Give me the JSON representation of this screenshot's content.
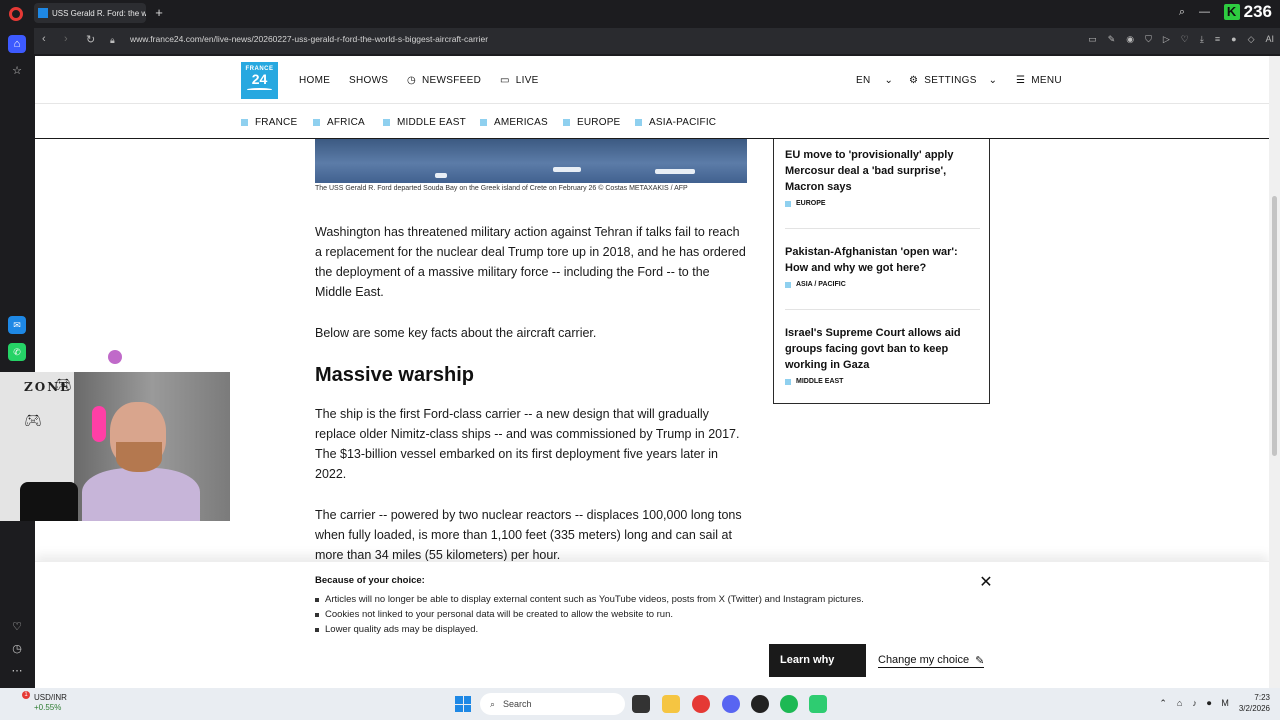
{
  "browser": {
    "tab_title": "USS Gerald R. Ford: the w",
    "url": "www.france24.com/en/live-news/20260227-uss-gerald-r-ford-the-world-s-biggest-aircraft-carrier",
    "counter_value": "236",
    "counter_badge": "K",
    "ai_label": "AI"
  },
  "header": {
    "logo_line1": "FRANCE",
    "logo_line2": "24",
    "nav": {
      "home": "HOME",
      "shows": "SHOWS",
      "newsfeed": "NEWSFEED",
      "live": "LIVE",
      "lang": "EN",
      "settings": "SETTINGS",
      "menu": "MENU"
    },
    "subnav": [
      "FRANCE",
      "AFRICA",
      "MIDDLE EAST",
      "AMERICAS",
      "EUROPE",
      "ASIA-PACIFIC"
    ]
  },
  "article": {
    "caption": "The USS Gerald R. Ford departed Souda Bay on the Greek island of Crete on February 26  © Costas METAXAKIS / AFP",
    "p1": "Washington has threatened military action against Tehran if talks fail to reach a replacement for the nuclear deal Trump tore up in 2018, and he has ordered the deployment of a massive military force -- including the Ford -- to the Middle East.",
    "p2": "Below are some key facts about the aircraft carrier.",
    "h2": "Massive warship",
    "p3": "The ship is the first Ford-class carrier -- a new design that will gradually replace older Nimitz-class ships -- and was commissioned by Trump in 2017. The $13-billion vessel embarked on its first deployment five years later in 2022.",
    "p4": "The carrier -- powered by two nuclear reactors -- displaces 100,000 long tons when fully loaded, is more than 1,100 feet (335 meters) long and can sail at more than 34 miles (55 kilometers) per hour."
  },
  "sidebar_news": [
    {
      "title": "EU move to 'provisionally' apply Mercosur deal a 'bad surprise', Macron says",
      "tag": "EUROPE"
    },
    {
      "title": "Pakistan-Afghanistan 'open war': How and why we got here?",
      "tag": "ASIA / PACIFIC"
    },
    {
      "title": "Israel's Supreme Court allows aid groups facing govt ban to keep working in Gaza",
      "tag": "MIDDLE EAST"
    }
  ],
  "consent": {
    "title": "Because of your choice:",
    "items": [
      "Articles will no longer be able to display external content such as YouTube videos, posts from X (Twitter) and Instagram pictures.",
      "Cookies not linked to your personal data will be created to allow the website to run.",
      "Lower quality ads may be displayed."
    ],
    "learn_why": "Learn why",
    "change_choice": "Change my choice"
  },
  "taskbar": {
    "ticker_label": "USD/INR",
    "ticker_change": "+0.55%",
    "ticker_badge": "1",
    "search_placeholder": "Search",
    "clock_time": "7:23",
    "clock_date": "3/2/2026",
    "tray_letter": "M"
  },
  "webcam": {
    "overlay_text": "ZONE"
  },
  "colors": {
    "accent": "#27a8e0",
    "tag_square": "#8fd0ef",
    "dark_button": "#1a1a1a"
  }
}
